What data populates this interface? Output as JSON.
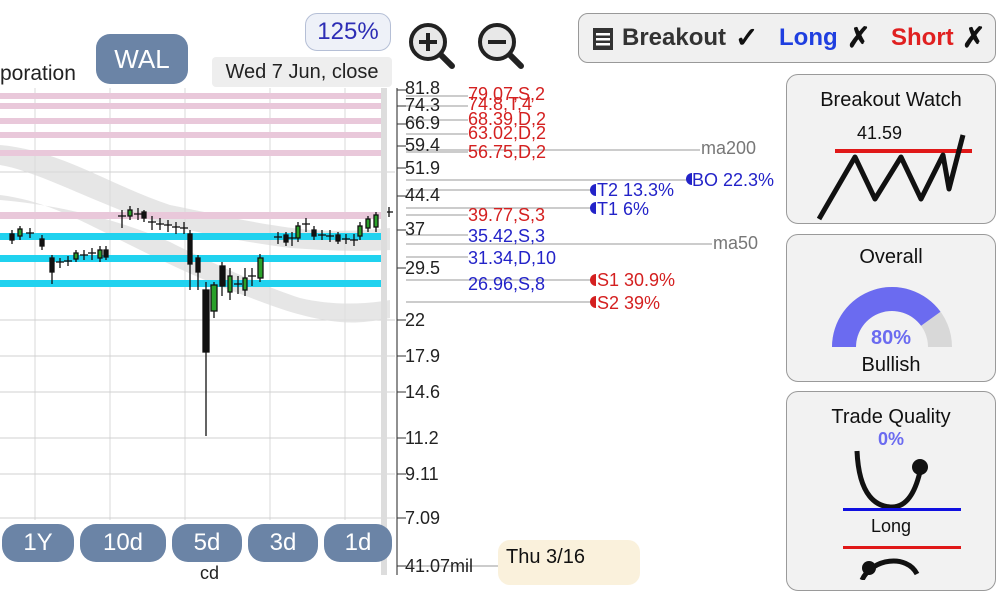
{
  "header": {
    "company_partial": "poration",
    "ticker": "WAL",
    "zoom_level": "125%",
    "date_label": "Wed 7 Jun, close"
  },
  "zoom_controls": {
    "zoom_in": "zoom-in-icon",
    "zoom_out": "zoom-out-icon"
  },
  "toolbar": {
    "breakout_label": "Breakout",
    "breakout_mark": "✓",
    "long_label": "Long",
    "long_mark": "✗",
    "short_label": "Short",
    "short_mark": "✗",
    "icon": "list-icon"
  },
  "price_axis": {
    "ticks": [
      "81.8",
      "74.3",
      "66.9",
      "59.4",
      "51.9",
      "44.4",
      "37",
      "29.5",
      "22",
      "17.9",
      "14.6",
      "11.2",
      "9.11",
      "7.09"
    ],
    "volume_label": "41.07mil"
  },
  "levels": [
    {
      "text": "79.07,S,2",
      "color": "#d42020",
      "price": 79.07
    },
    {
      "text": "74.8,T,4",
      "color": "#d42020",
      "price": 74.8
    },
    {
      "text": "68.39,D,2",
      "color": "#d42020",
      "price": 68.39
    },
    {
      "text": "63.02,D,2",
      "color": "#d42020",
      "price": 63.02
    },
    {
      "text": "56.75,D,2",
      "color": "#d42020",
      "price": 56.75
    },
    {
      "text": "39.77,S,3",
      "color": "#d42020",
      "price": 39.77
    },
    {
      "text": "35.42,S,3",
      "color": "#2323c8",
      "price": 35.42
    },
    {
      "text": "31.34,D,10",
      "color": "#2323c8",
      "price": 31.34
    },
    {
      "text": "26.96,S,8",
      "color": "#2323c8",
      "price": 26.96
    }
  ],
  "markers": {
    "ma200": "ma200",
    "ma50": "ma50",
    "bo": "BO 22.3%",
    "t2": "T2 13.3%",
    "t1": "T1 6%",
    "s1": "S1 30.9%",
    "s2": "S2 39%"
  },
  "periods": [
    "1Y",
    "10d",
    "5d",
    "3d",
    "1d"
  ],
  "bottom_partial": "cd",
  "tooltip_date": "Thu 3/16",
  "cards": {
    "breakout_watch": {
      "title": "Breakout Watch",
      "value": "41.59"
    },
    "overall": {
      "title": "Overall",
      "value": "80%",
      "fraction": 0.8,
      "label": "Bullish"
    },
    "trade_quality": {
      "title": "Trade Quality",
      "value": "0%",
      "label": "Long"
    }
  },
  "colors": {
    "pill": "#6b84a6",
    "resistance_band": "#e6c3d6",
    "support_band": "#22d3f0",
    "up_candle": "#2aa12a",
    "gauge": "#6b6bf0",
    "red": "#d42020",
    "blue": "#2323c8"
  }
}
